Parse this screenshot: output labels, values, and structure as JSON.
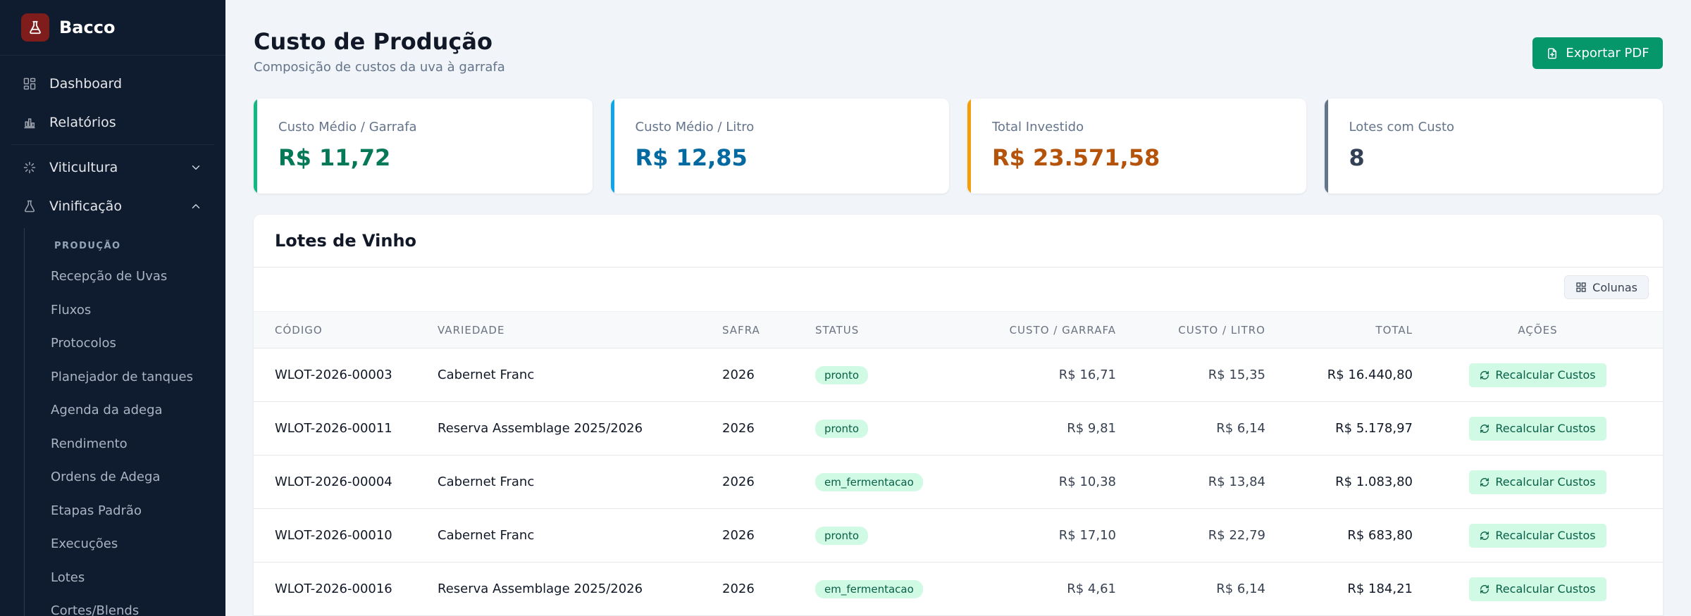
{
  "brand": {
    "name": "Bacco",
    "logo_icon": "flask-icon",
    "logo_color": "#7f1d1d"
  },
  "sidebar": {
    "top_items": [
      {
        "label": "Dashboard",
        "icon": "dashboard-icon"
      },
      {
        "label": "Relatórios",
        "icon": "bar-chart-icon"
      }
    ],
    "groups": [
      {
        "label": "Viticultura",
        "icon": "vine-icon",
        "expanded": false
      },
      {
        "label": "Vinificação",
        "icon": "flask-icon",
        "expanded": true
      }
    ],
    "section_header": "PRODUÇÃO",
    "sub_items": [
      "Recepção de Uvas",
      "Fluxos",
      "Protocolos",
      "Planejador de tanques",
      "Agenda da adega",
      "Rendimento",
      "Ordens de Adega",
      "Etapas Padrão",
      "Execuções",
      "Lotes",
      "Cortes/Blends"
    ]
  },
  "page": {
    "title": "Custo de Produção",
    "subtitle": "Composição de custos da uva à garrafa",
    "export_label": "Exportar PDF"
  },
  "cards": [
    {
      "label": "Custo Médio / Garrafa",
      "value": "R$ 11,72",
      "accent": "#10b981",
      "value_color": "#047857"
    },
    {
      "label": "Custo Médio / Litro",
      "value": "R$ 12,85",
      "accent": "#0ea5e9",
      "value_color": "#0369a1"
    },
    {
      "label": "Total Investido",
      "value": "R$ 23.571,58",
      "accent": "#f59e0b",
      "value_color": "#b45309"
    },
    {
      "label": "Lotes com Custo",
      "value": "8",
      "accent": "#64748b",
      "value_color": "#334155"
    }
  ],
  "table": {
    "title": "Lotes de Vinho",
    "columns_button": "Colunas",
    "headers": {
      "codigo": "CÓDIGO",
      "variedade": "VARIEDADE",
      "safra": "SAFRA",
      "status": "STATUS",
      "custo_garrafa": "CUSTO / GARRAFA",
      "custo_litro": "CUSTO / LITRO",
      "total": "TOTAL",
      "acoes": "AÇÕES"
    },
    "action_label": "Recalcular Custos",
    "rows": [
      {
        "codigo": "WLOT-2026-00003",
        "variedade": "Cabernet Franc",
        "safra": "2026",
        "status": "pronto",
        "custo_garrafa": "R$ 16,71",
        "custo_litro": "R$ 15,35",
        "total": "R$ 16.440,80"
      },
      {
        "codigo": "WLOT-2026-00011",
        "variedade": "Reserva Assemblage 2025/2026",
        "safra": "2026",
        "status": "pronto",
        "custo_garrafa": "R$ 9,81",
        "custo_litro": "R$ 6,14",
        "total": "R$ 5.178,97"
      },
      {
        "codigo": "WLOT-2026-00004",
        "variedade": "Cabernet Franc",
        "safra": "2026",
        "status": "em_fermentacao",
        "custo_garrafa": "R$ 10,38",
        "custo_litro": "R$ 13,84",
        "total": "R$ 1.083,80"
      },
      {
        "codigo": "WLOT-2026-00010",
        "variedade": "Cabernet Franc",
        "safra": "2026",
        "status": "pronto",
        "custo_garrafa": "R$ 17,10",
        "custo_litro": "R$ 22,79",
        "total": "R$ 683,80"
      },
      {
        "codigo": "WLOT-2026-00016",
        "variedade": "Reserva Assemblage 2025/2026",
        "safra": "2026",
        "status": "em_fermentacao",
        "custo_garrafa": "R$ 4,61",
        "custo_litro": "R$ 6,14",
        "total": "R$ 184,21"
      }
    ]
  }
}
